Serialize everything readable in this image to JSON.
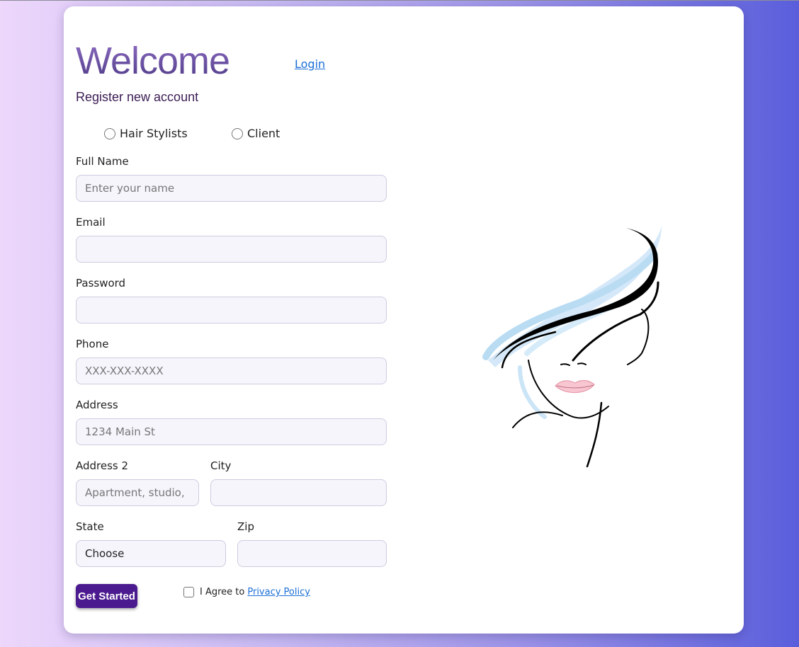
{
  "header": {
    "title": "Welcome",
    "login_link": "Login",
    "subtitle": "Register new account"
  },
  "account_type": {
    "options": [
      "Hair Stylists",
      "Client"
    ]
  },
  "form": {
    "full_name": {
      "label": "Full Name",
      "value": "",
      "placeholder": "Enter your name"
    },
    "email": {
      "label": "Email",
      "value": "",
      "placeholder": ""
    },
    "password": {
      "label": "Password",
      "value": "",
      "placeholder": ""
    },
    "phone": {
      "label": "Phone",
      "value": "",
      "placeholder": "XXX-XXX-XXXX"
    },
    "address": {
      "label": "Address",
      "value": "",
      "placeholder": "1234 Main St"
    },
    "address2": {
      "label": "Address 2",
      "value": "",
      "placeholder": "Apartment, studio,"
    },
    "city": {
      "label": "City",
      "value": "",
      "placeholder": ""
    },
    "state": {
      "label": "State",
      "selected": "Choose"
    },
    "zip": {
      "label": "Zip",
      "value": "",
      "placeholder": ""
    }
  },
  "footer": {
    "submit_label": "Get Started",
    "agree_text": "I Agree to",
    "privacy_link": "Privacy Policy"
  },
  "colors": {
    "button": "#4b1a8f",
    "link": "#1b6fd6",
    "title_gradient_top": "#8f6dc4",
    "title_gradient_bottom": "#4d3a86"
  }
}
